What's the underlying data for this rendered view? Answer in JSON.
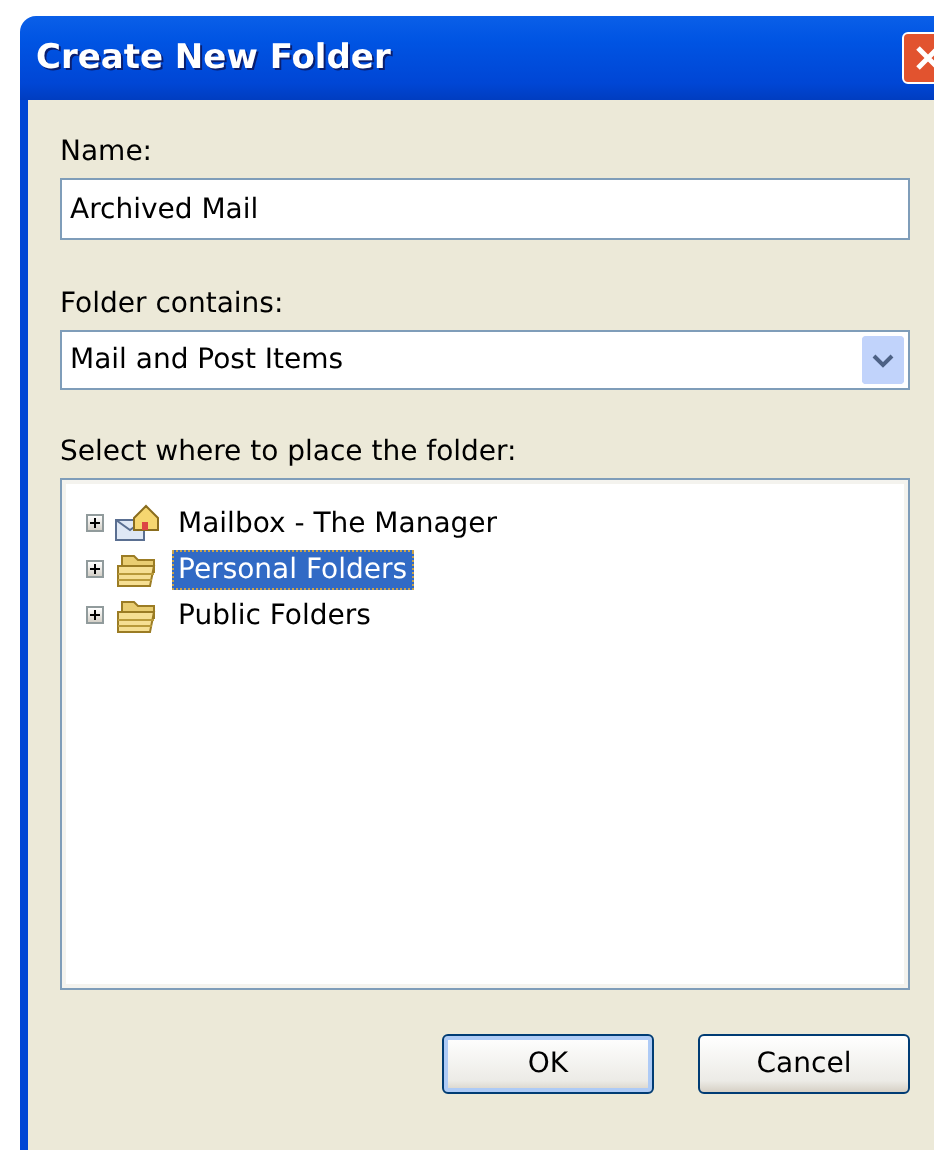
{
  "window": {
    "title": "Create New Folder"
  },
  "name_field": {
    "label": "Name:",
    "value": "Archived Mail"
  },
  "contains_field": {
    "label": "Folder contains:",
    "value": "Mail and Post Items"
  },
  "location": {
    "label": "Select where to place the folder:",
    "items": [
      {
        "label": "Mailbox - The Manager",
        "kind": "mailbox",
        "expanded": false,
        "selected": false
      },
      {
        "label": "Personal Folders",
        "kind": "folders",
        "expanded": false,
        "selected": true
      },
      {
        "label": "Public Folders",
        "kind": "folders",
        "expanded": false,
        "selected": false
      }
    ]
  },
  "buttons": [
    {
      "label": "OK",
      "default": true
    },
    {
      "label": "Cancel",
      "default": false
    }
  ]
}
